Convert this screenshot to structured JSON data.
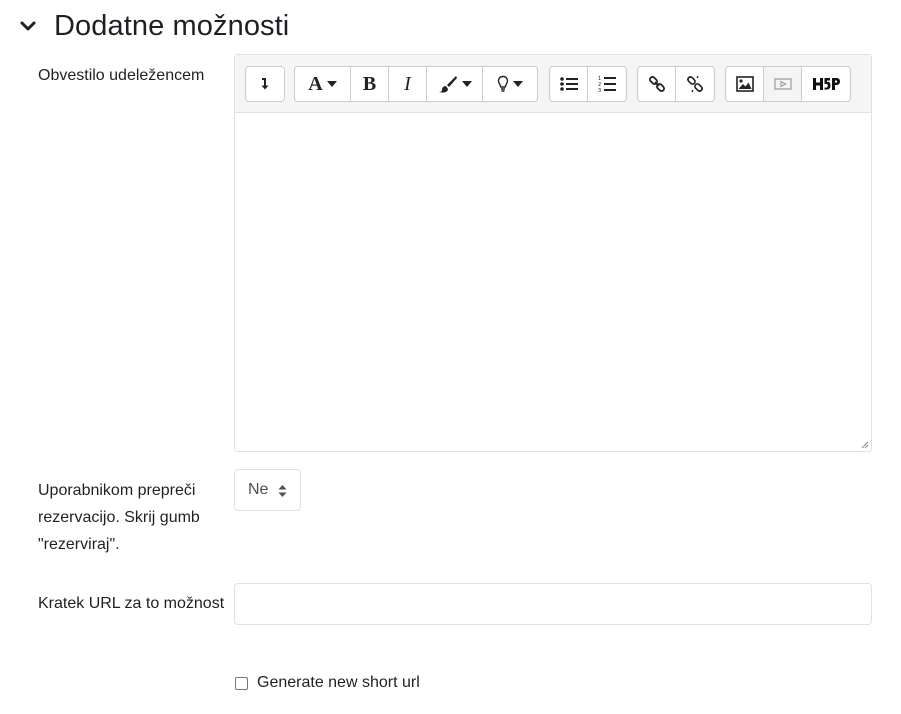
{
  "section": {
    "title": "Dodatne možnosti",
    "toggle_icon": "chevron-down-icon"
  },
  "editor": {
    "label": "Obvestilo udeležencem",
    "toolbar": {
      "groups": [
        [
          "toggle-toolbar-icon"
        ],
        [
          "font-style-icon",
          "bold-icon",
          "italic-icon",
          "text-color-icon",
          "lightbulb-icon"
        ],
        [
          "unordered-list-icon",
          "ordered-list-icon"
        ],
        [
          "link-icon",
          "unlink-icon"
        ],
        [
          "image-icon",
          "media-icon",
          "h5p-icon"
        ]
      ],
      "bold_glyph": "B",
      "italic_glyph": "I",
      "font_glyph": "A"
    },
    "content": ""
  },
  "prevent_booking": {
    "label": "Uporabnikom prepreči rezervacijo. Skrij gumb \"rezerviraj\".",
    "selected": "Ne"
  },
  "short_url": {
    "label": "Kratek URL za to možnost",
    "value": ""
  },
  "generate_short_url": {
    "label": "Generate new short url",
    "checked": false
  }
}
